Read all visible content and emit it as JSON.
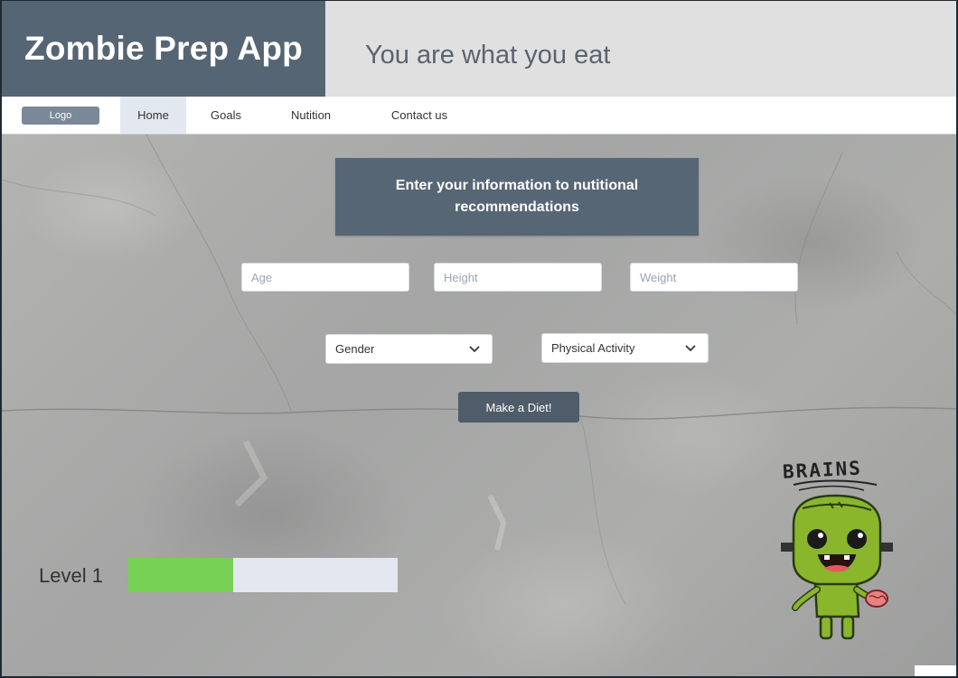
{
  "header": {
    "app_title": "Zombie Prep App",
    "tagline": "You are what you eat"
  },
  "nav": {
    "logo_label": "Logo",
    "items": [
      {
        "label": "Home",
        "active": true
      },
      {
        "label": "Goals",
        "active": false
      },
      {
        "label": "Nutition",
        "active": false
      },
      {
        "label": "Contact us",
        "active": false
      }
    ]
  },
  "form": {
    "title": "Enter your information to nutitional recommendations",
    "age": {
      "placeholder": "Age",
      "value": ""
    },
    "height": {
      "placeholder": "Height",
      "value": ""
    },
    "weight": {
      "placeholder": "Weight",
      "value": ""
    },
    "gender": {
      "selected": "Gender",
      "icon": "chevron-down-icon"
    },
    "activity": {
      "selected": "Physical Activity",
      "icon": "chevron-down-icon"
    },
    "submit_label": "Make a Diet!"
  },
  "level": {
    "label": "Level 1",
    "progress": 0.39
  },
  "mascot": {
    "caption": "BRAINS",
    "icon": "zombie-mascot-icon"
  },
  "colors": {
    "brand_bg": "#566573",
    "nav_active_bg": "#e3e7ef",
    "button_bg": "#4f5c69",
    "progress_fill": "#77d154",
    "zombie_green": "#8ab62c"
  }
}
